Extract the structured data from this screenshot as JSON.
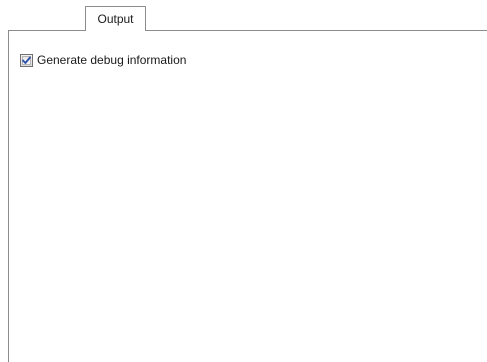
{
  "tabs": [
    {
      "label": "Output",
      "selected": true
    }
  ],
  "output_page": {
    "generate_debug": {
      "label": "Generate debug information",
      "checked": true
    }
  },
  "colors": {
    "tab_border": "#8c8c8c",
    "check_mark": "#2a4ea6"
  },
  "icons": {
    "check": "check-mark-icon"
  }
}
